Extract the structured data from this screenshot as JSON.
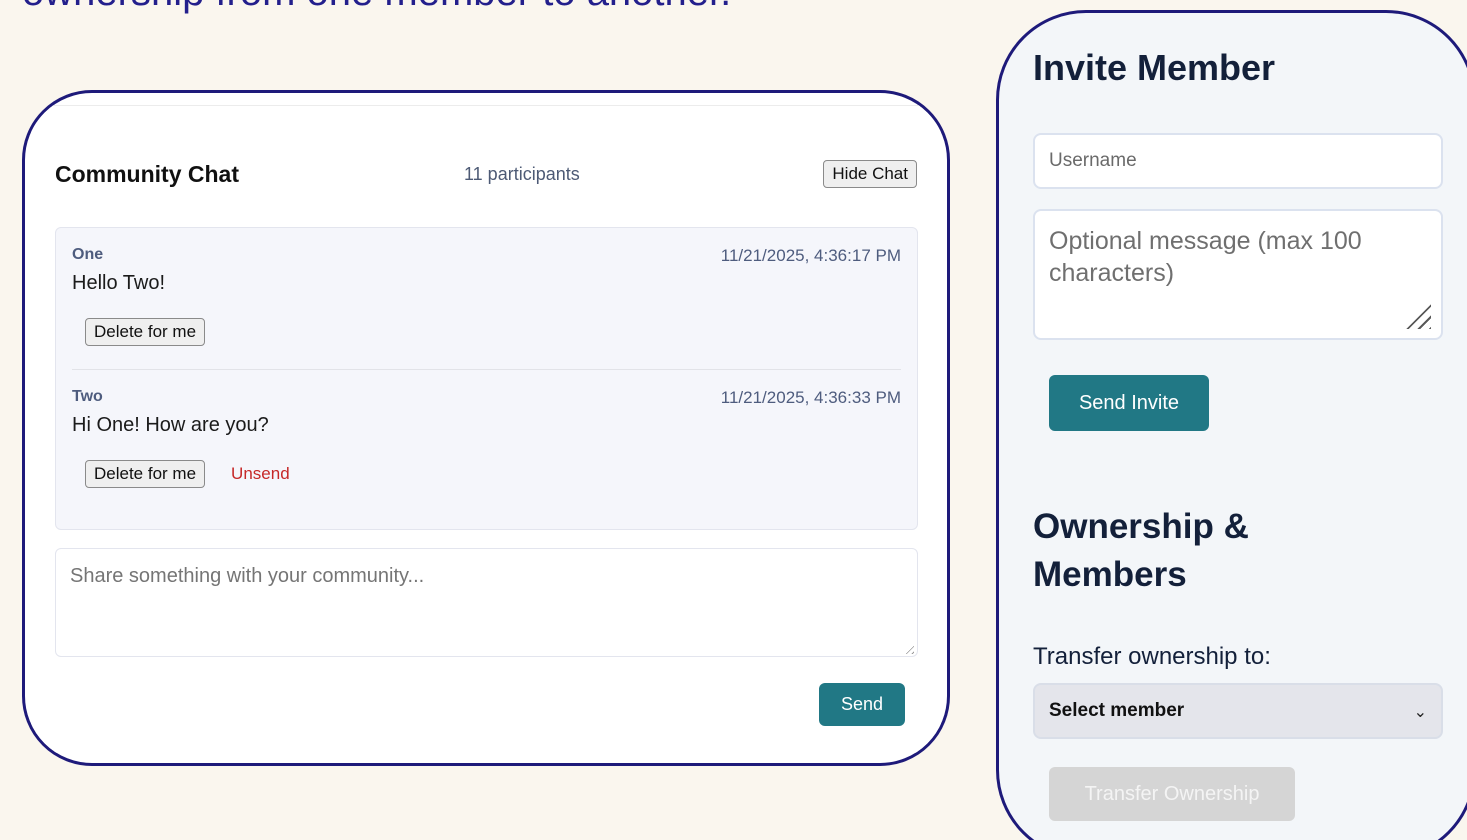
{
  "caption": {
    "text": "ownership from one member to another."
  },
  "chat": {
    "title": "Community Chat",
    "participants": "11 participants",
    "hide_button": "Hide Chat",
    "messages": [
      {
        "author": "One",
        "timestamp": "11/21/2025, 4:36:17 PM",
        "text": "Hello Two!",
        "actions": {
          "delete": "Delete for me"
        }
      },
      {
        "author": "Two",
        "timestamp": "11/21/2025, 4:36:33 PM",
        "text": "Hi One! How are you?",
        "actions": {
          "delete": "Delete for me",
          "unsend": "Unsend"
        }
      }
    ],
    "compose_placeholder": "Share something with your community...",
    "send_button": "Send"
  },
  "invite": {
    "title": "Invite Member",
    "username_placeholder": "Username",
    "message_placeholder": "Optional message (max 100 characters)",
    "send_button": "Send Invite"
  },
  "ownership": {
    "title": "Ownership & Members",
    "transfer_label": "Transfer ownership to:",
    "select_value": "Select member",
    "transfer_button": "Transfer Ownership"
  },
  "colors": {
    "accent": "#217885",
    "frame": "#1e1a7a",
    "danger": "#c62828",
    "background": "#faf6ee"
  }
}
